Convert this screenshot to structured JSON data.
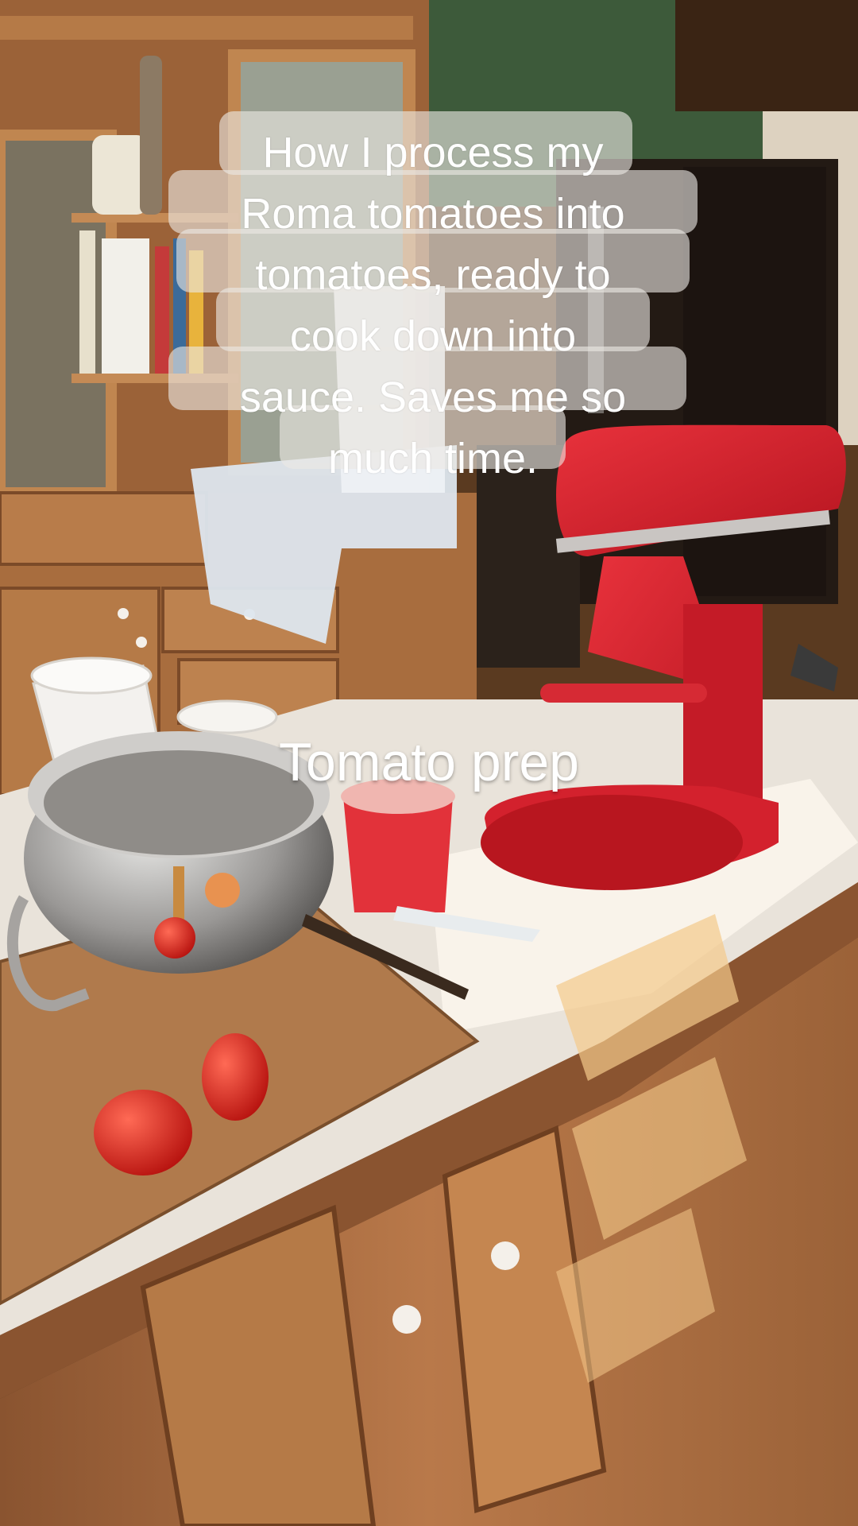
{
  "overlay": {
    "caption": "How I process my\nRoma tomatoes into\ntomatoes, ready to\ncook down into\nsauce. Saves me so\nmuch time.",
    "label": "Tomato prep"
  },
  "colors": {
    "mixer_red": "#d61f2c",
    "cabinet_wood": "#b9794a",
    "counter_white": "#e9e3da",
    "wall_green": "#3d5a3a",
    "tomato_red": "#e0261f"
  }
}
